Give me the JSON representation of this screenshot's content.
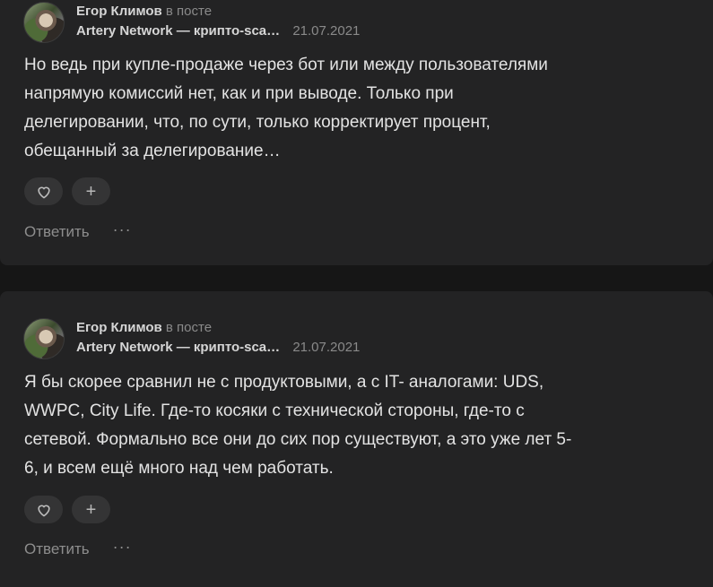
{
  "comments": [
    {
      "author": "Егор Климов",
      "in_post_label": "в посте",
      "post_title": "Artery Network — крипто-sca…",
      "date": "21.07.2021",
      "body_lines": [
        "Но ведь при купле-продаже через бот или между пользователями",
        "напрямую комиссий нет, как и при выводе. Только при",
        "делегировании, что, по сути, только корректирует процент,",
        "обещанный за делегирование…"
      ],
      "like_icon": "heart-icon",
      "add_reaction_label": "+",
      "reply_label": "Ответить",
      "more_label": "···"
    },
    {
      "author": "Егор Климов",
      "in_post_label": "в посте",
      "post_title": "Artery Network — крипто-sca…",
      "date": "21.07.2021",
      "body_lines": [
        "Я бы скорее сравнил не с продуктовыми, а с IT- аналогами: UDS,",
        "WWPC, City Life. Где-то косяки с технической стороны, где-то с",
        "сетевой. Формально все они до сих пор существуют, а это уже лет 5-",
        "6, и всем ещё много над чем работать."
      ],
      "like_icon": "heart-icon",
      "add_reaction_label": "+",
      "reply_label": "Ответить",
      "more_label": "···"
    }
  ]
}
